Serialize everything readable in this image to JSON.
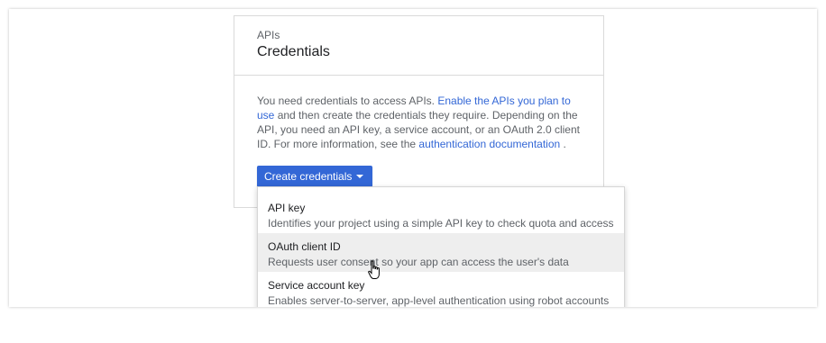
{
  "card": {
    "eyebrow": "APIs",
    "title": "Credentials",
    "desc": {
      "part1": "You need credentials to access APIs. ",
      "link1": "Enable the APIs you plan to use",
      "part2": " and then create the credentials they require. Depending on the API, you need an API key, a service account, or an OAuth 2.0 client ID. For more information, see the ",
      "link2": "authentication documentation",
      "part3": " ."
    },
    "button_label": "Create credentials"
  },
  "menu": {
    "items": [
      {
        "title": "API key",
        "desc": "Identifies your project using a simple API key to check quota and access"
      },
      {
        "title": "OAuth client ID",
        "desc": "Requests user consent so your app can access the user's data"
      },
      {
        "title": "Service account key",
        "desc": "Enables server-to-server, app-level authentication using robot accounts"
      }
    ],
    "hovered_item": "OAuth client ID"
  },
  "colors": {
    "accent": "#3367d6",
    "hover_bg": "#eeeeee"
  }
}
